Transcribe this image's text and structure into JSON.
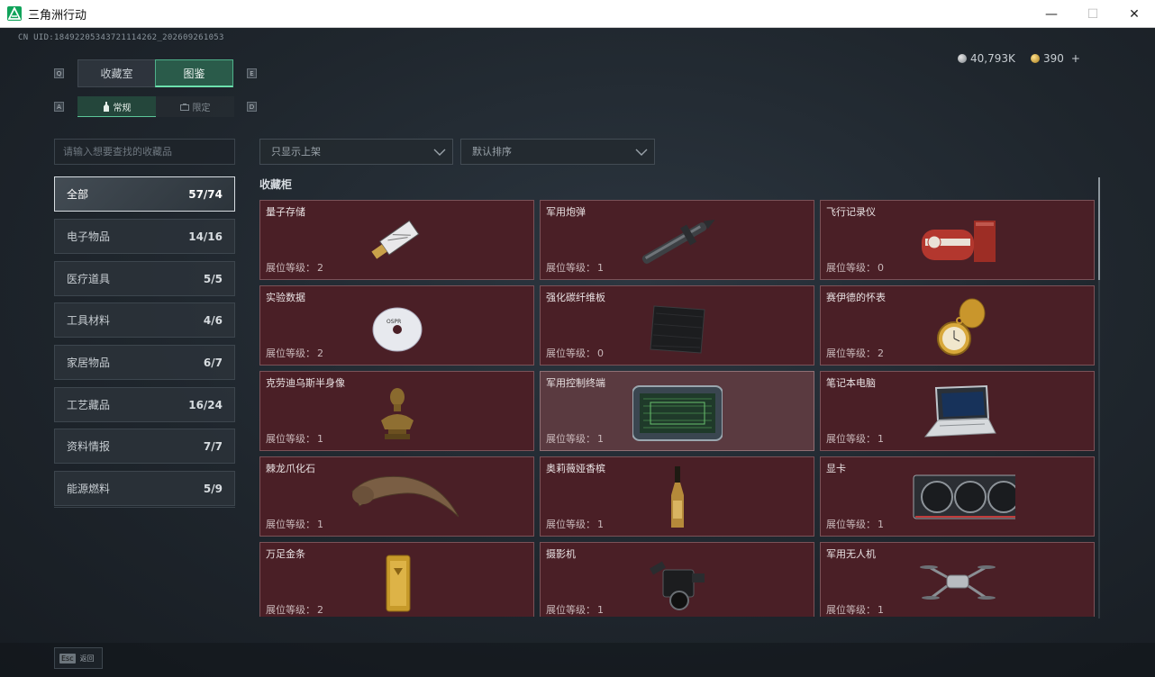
{
  "window": {
    "title": "三角洲行动",
    "minimize": "—",
    "maximize": "☐",
    "close": "✕"
  },
  "uid": "CN UID:18492205343721114262_202609261053",
  "currency": {
    "silver": "40,793K",
    "gold": "390",
    "add": "+"
  },
  "main_tabs": [
    {
      "label": "收藏室",
      "active": false
    },
    {
      "label": "图鉴",
      "active": true
    }
  ],
  "main_tab_keys": {
    "left": "Q",
    "right": "E"
  },
  "sub_tabs": [
    {
      "label": "常规",
      "icon": "bottle-icon",
      "active": true
    },
    {
      "label": "限定",
      "icon": "case-icon",
      "active": false
    }
  ],
  "sub_tab_keys": {
    "left": "A",
    "right": "D"
  },
  "search": {
    "placeholder": "请输入想要查找的收藏品"
  },
  "filters": [
    {
      "label": "只显示上架"
    },
    {
      "label": "默认排序"
    }
  ],
  "categories": [
    {
      "label": "全部",
      "count": "57/74",
      "active": true
    },
    {
      "label": "电子物品",
      "count": "14/16",
      "active": false
    },
    {
      "label": "医疗道具",
      "count": "5/5",
      "active": false
    },
    {
      "label": "工具材料",
      "count": "4/6",
      "active": false
    },
    {
      "label": "家居物品",
      "count": "6/7",
      "active": false
    },
    {
      "label": "工艺藏品",
      "count": "16/24",
      "active": false
    },
    {
      "label": "资料情报",
      "count": "7/7",
      "active": false
    },
    {
      "label": "能源燃料",
      "count": "5/9",
      "active": false
    }
  ],
  "section": {
    "title": "收藏柜"
  },
  "level_prefix": "展位等级：",
  "items": [
    {
      "name": "量子存储",
      "level": "2",
      "icon": "usb-drive-icon"
    },
    {
      "name": "军用炮弹",
      "level": "1",
      "icon": "artillery-shell-icon"
    },
    {
      "name": "飞行记录仪",
      "level": "0",
      "icon": "flight-recorder-icon"
    },
    {
      "name": "实验数据",
      "level": "2",
      "icon": "disc-icon"
    },
    {
      "name": "强化碳纤维板",
      "level": "0",
      "icon": "carbon-plate-icon"
    },
    {
      "name": "赛伊德的怀表",
      "level": "2",
      "icon": "pocket-watch-icon"
    },
    {
      "name": "克劳迪乌斯半身像",
      "level": "1",
      "icon": "bust-icon"
    },
    {
      "name": "军用控制终端",
      "level": "1",
      "icon": "control-terminal-icon"
    },
    {
      "name": "笔记本电脑",
      "level": "1",
      "icon": "laptop-icon"
    },
    {
      "name": "棘龙爪化石",
      "level": "1",
      "icon": "claw-fossil-icon"
    },
    {
      "name": "奥莉薇娅香槟",
      "level": "1",
      "icon": "champagne-icon"
    },
    {
      "name": "显卡",
      "level": "1",
      "icon": "graphics-card-icon"
    },
    {
      "name": "万足金条",
      "level": "2",
      "icon": "gold-bar-icon"
    },
    {
      "name": "摄影机",
      "level": "1",
      "icon": "camera-icon"
    },
    {
      "name": "军用无人机",
      "level": "1",
      "icon": "drone-icon"
    }
  ],
  "footer": {
    "key": "Esc",
    "label": "返回"
  },
  "colors": {
    "accent": "#5cc79a",
    "card_bg": "#4a1f26",
    "card_border": "#7a5258"
  }
}
